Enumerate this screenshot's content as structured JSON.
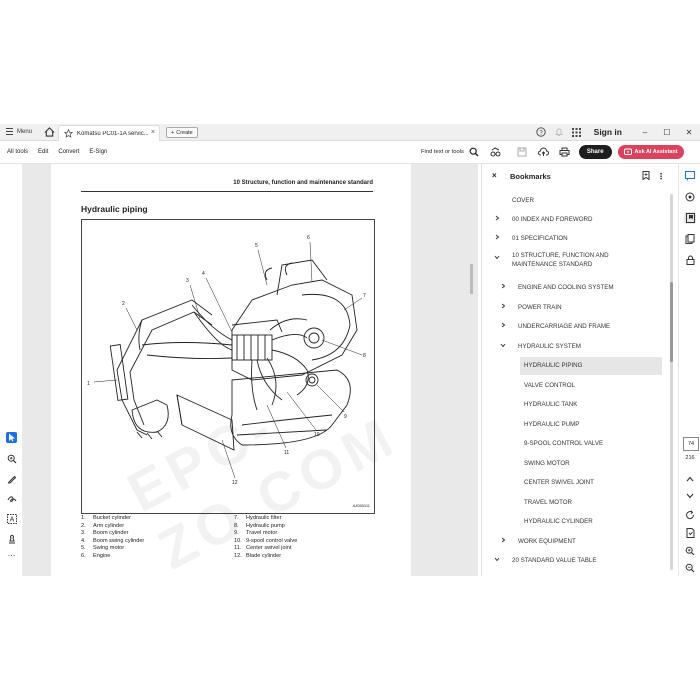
{
  "titlebar": {
    "menu_label": "Menu",
    "tab_title": "Komatsu PC01-1A servic...",
    "create_label": "Create",
    "sign_in": "Sign in"
  },
  "toolbar": {
    "all_tools": "All tools",
    "edit": "Edit",
    "convert": "Convert",
    "esign": "E-Sign",
    "find": "Find text or tools",
    "share": "Share",
    "ai": "Ask AI Assistant"
  },
  "page": {
    "header": "10 Structure, function and maintenance standard",
    "title": "Hydraulic piping",
    "figure_code": "AJ050111",
    "watermark": "EPC-ZO.COM",
    "labels": [
      "1",
      "2",
      "3",
      "4",
      "5",
      "6",
      "7",
      "8",
      "9",
      "10",
      "11",
      "12"
    ],
    "legend_left": [
      {
        "n": "1.",
        "t": "Bucket cylinder"
      },
      {
        "n": "2.",
        "t": "Arm cylinder"
      },
      {
        "n": "3.",
        "t": "Boom cylinder"
      },
      {
        "n": "4.",
        "t": "Boom swing cylinder"
      },
      {
        "n": "5.",
        "t": "Swing motor"
      },
      {
        "n": "6.",
        "t": "Engine"
      }
    ],
    "legend_right": [
      {
        "n": "7.",
        "t": "Hydraulic filter"
      },
      {
        "n": "8.",
        "t": "Hydraulic pump"
      },
      {
        "n": "9.",
        "t": "Travel motor"
      },
      {
        "n": "10.",
        "t": "9-spool control valve"
      },
      {
        "n": "11.",
        "t": "Center swivel joint"
      },
      {
        "n": "12.",
        "t": "Blade cylinder"
      }
    ]
  },
  "bookmarks": {
    "title": "Bookmarks",
    "items": [
      {
        "label": "COVER",
        "chevron": "none",
        "level": 0
      },
      {
        "label": "00 INDEX AND FOREWORD",
        "chevron": "right",
        "level": 0
      },
      {
        "label": "01 SPECIFICATION",
        "chevron": "right",
        "level": 0
      },
      {
        "label": "10 STRUCTURE, FUNCTION AND",
        "label2": "MAINTENANCE STANDARD",
        "chevron": "down",
        "level": 0
      },
      {
        "label": "ENGINE AND COOLING SYSTEM",
        "chevron": "right",
        "level": 1
      },
      {
        "label": "POWER TRAIN",
        "chevron": "right",
        "level": 1
      },
      {
        "label": "UNDERCARRIAGE AND FRAME",
        "chevron": "right",
        "level": 1
      },
      {
        "label": "HYDRAULIC SYSTEM",
        "chevron": "down",
        "level": 1
      },
      {
        "label": "HYDRAULIC PIPING",
        "chevron": "none",
        "level": 2,
        "selected": true
      },
      {
        "label": "VALVE CONTROL",
        "chevron": "none",
        "level": 2
      },
      {
        "label": "HYDRAULIC TANK",
        "chevron": "none",
        "level": 2
      },
      {
        "label": "HYDRAULIC PUMP",
        "chevron": "none",
        "level": 2
      },
      {
        "label": "9-SPOOL CONTROL VALVE",
        "chevron": "none",
        "level": 2
      },
      {
        "label": "SWING MOTOR",
        "chevron": "none",
        "level": 2
      },
      {
        "label": "CENTER SWIVEL JOINT",
        "chevron": "none",
        "level": 2
      },
      {
        "label": "TRAVEL MOTOR",
        "chevron": "none",
        "level": 2
      },
      {
        "label": "HYDRAULIC CYLINDER",
        "chevron": "none",
        "level": 2
      },
      {
        "label": "WORK EQUIPMENT",
        "chevron": "right",
        "level": 1
      },
      {
        "label": "20 STANDARD VALUE TABLE",
        "chevron": "down",
        "level": 0
      }
    ]
  },
  "pagenav": {
    "current": "74",
    "total": "216"
  },
  "colors": {
    "accent": "#1d6ee6",
    "ai_button": "#d9435d",
    "share_button": "#1e1e1e"
  }
}
